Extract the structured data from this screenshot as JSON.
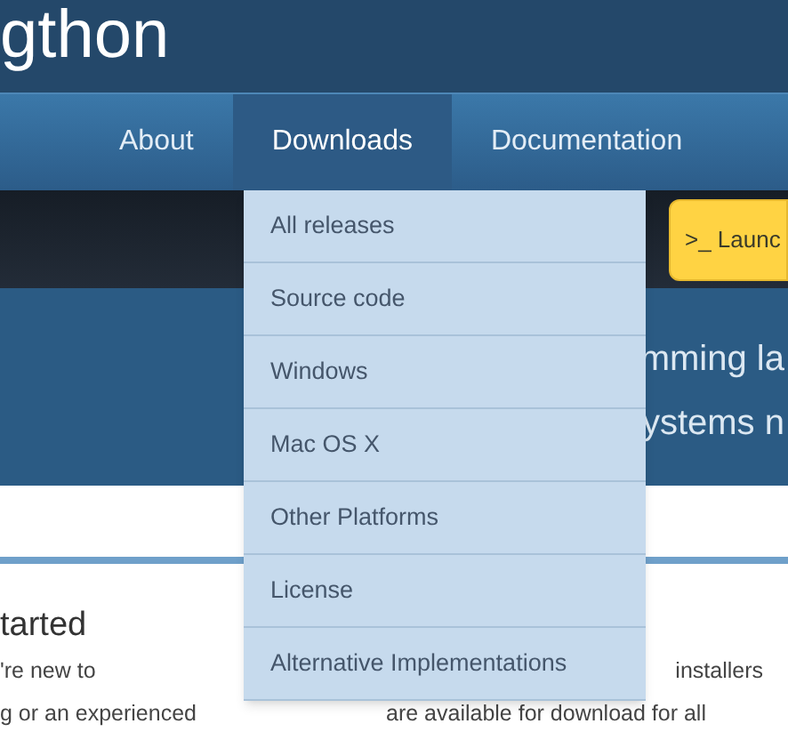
{
  "logo": {
    "text": "gthon"
  },
  "nav": [
    {
      "label": "About",
      "selected": false
    },
    {
      "label": "Downloads",
      "selected": true
    },
    {
      "label": "Documentation",
      "selected": false
    }
  ],
  "launch_button": {
    "label": ">_ Launc"
  },
  "hero": {
    "lines": [
      "mming la",
      "ystems n"
    ]
  },
  "dropdown": {
    "items": [
      "All releases",
      "Source code",
      "Windows",
      "Mac OS X",
      "Other Platforms",
      "License",
      "Alternative Implementations"
    ]
  },
  "get_started": {
    "heading": "tarted",
    "lines": [
      "'re new to",
      "g or an experienced"
    ]
  },
  "downloads_blurb": {
    "lines": [
      "installers",
      "are available for download for all"
    ]
  }
}
